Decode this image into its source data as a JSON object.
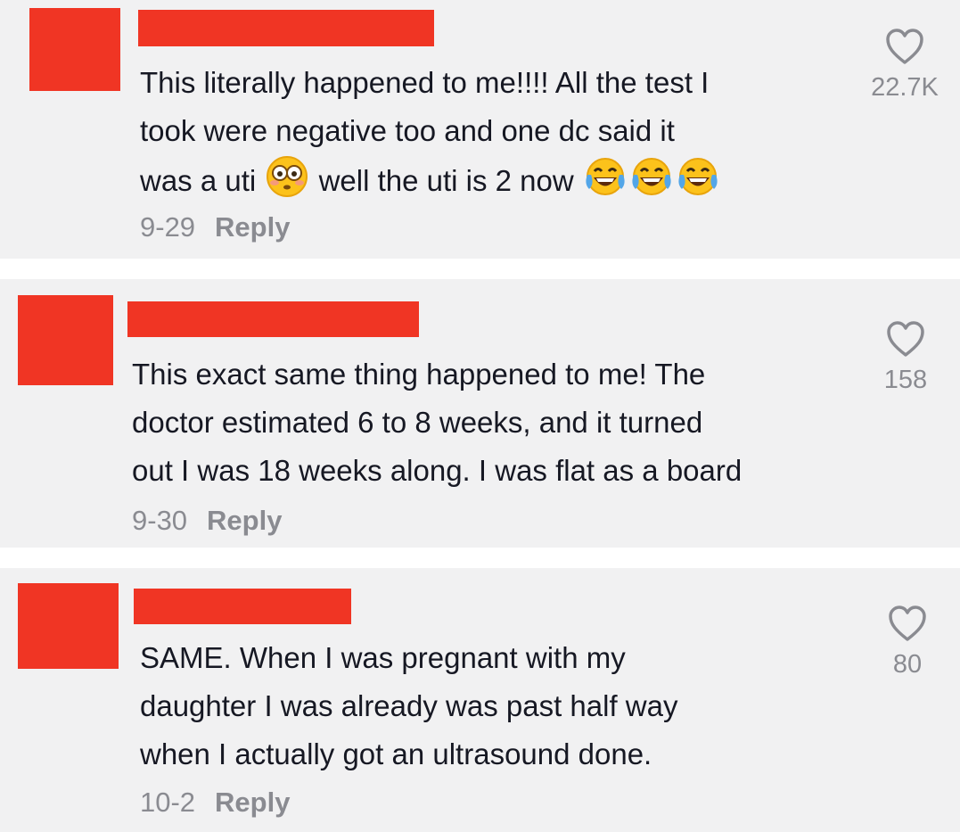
{
  "comments": [
    {
      "lines": [
        "This literally happened to me!!!! All the test I",
        "took were negative too and one dc said it",
        "was a uti",
        "well the uti is 2 now"
      ],
      "emoji": [
        "flushed-face",
        "face-with-tears-of-joy",
        "face-with-tears-of-joy",
        "face-with-tears-of-joy"
      ],
      "date": "9-29",
      "reply": "Reply",
      "likes": "22.7K"
    },
    {
      "lines": [
        "This exact same thing happened to me! The",
        "doctor estimated 6 to 8 weeks, and it turned",
        "out I was 18 weeks along. I was flat as a board"
      ],
      "date": "9-30",
      "reply": "Reply",
      "likes": "158"
    },
    {
      "lines": [
        "SAME. When I was pregnant with my",
        "daughter I was already was past half way",
        "when I actually got an ultrasound done."
      ],
      "date": "10-2",
      "reply": "Reply",
      "likes": "80"
    }
  ],
  "colors": {
    "redaction": "#f03524",
    "card_background": "#f1f1f2",
    "text": "#161823",
    "muted": "#8a8b91"
  }
}
